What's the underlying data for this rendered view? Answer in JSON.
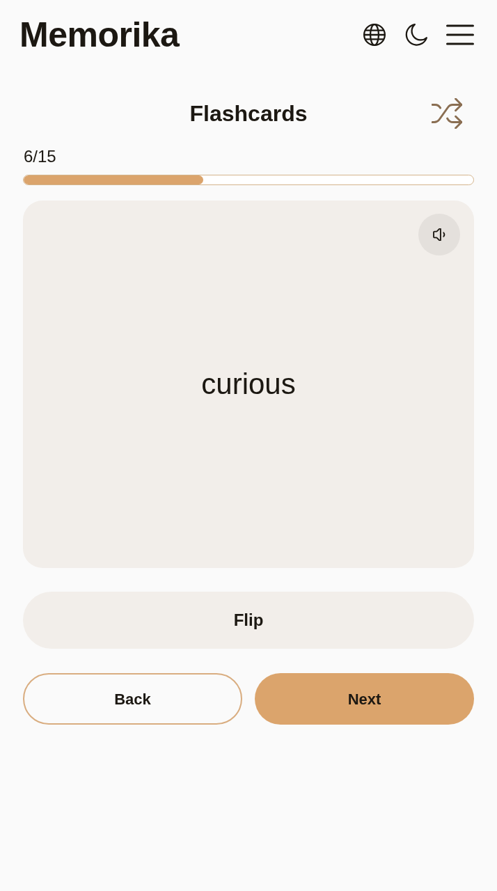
{
  "header": {
    "logo": "Memorika"
  },
  "deck": {
    "title": "Flashcards"
  },
  "progress": {
    "count": "6/15",
    "level": 0.4
  },
  "card": {
    "word": "curious"
  },
  "buttons": [
    {
      "label": "Flip",
      "kind": "secondary"
    },
    {
      "label": "Back",
      "kind": "outline"
    },
    {
      "label": "Next",
      "kind": "primary"
    }
  ]
}
